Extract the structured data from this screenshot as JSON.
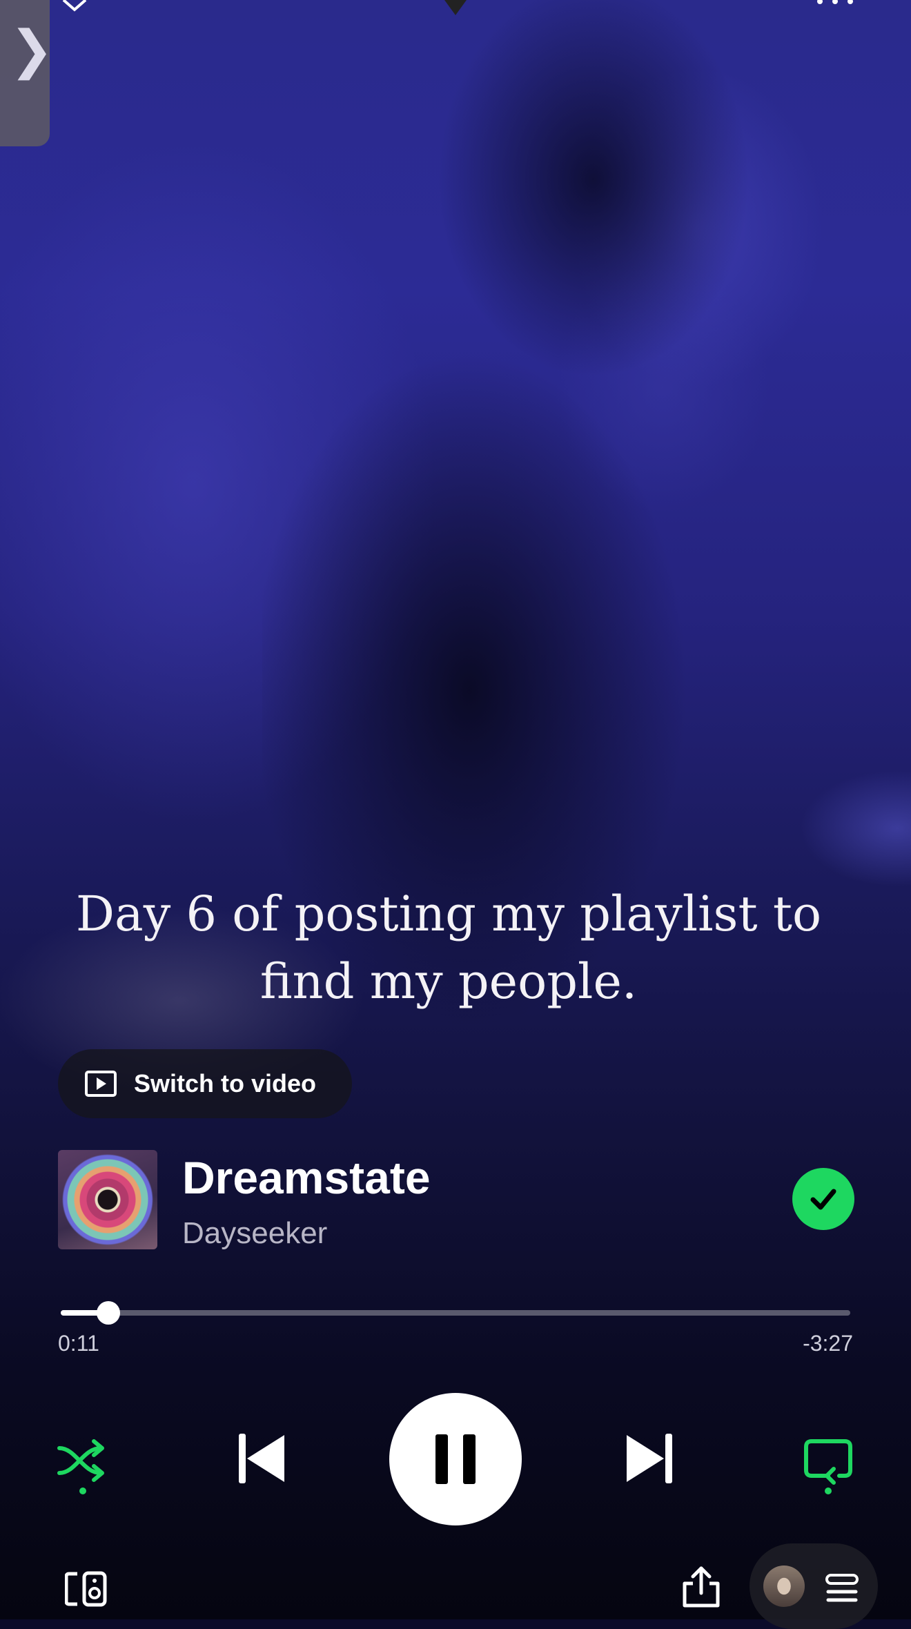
{
  "caption": "Day 6 of posting my playlist to find my people.",
  "switch_video": {
    "label": "Switch to video"
  },
  "track": {
    "title": "Dreamstate",
    "artist": "Dayseeker",
    "saved": true
  },
  "playback": {
    "elapsed": "0:11",
    "remaining": "-3:27",
    "progress_fraction": 0.06,
    "state": "playing"
  },
  "controls": {
    "shuffle_active": true,
    "repeat_active": true
  },
  "colors": {
    "accent": "#1ed760",
    "background_top": "#2c2b95",
    "background_bottom": "#050510"
  },
  "icons": {
    "side_tab": "chevron-right-icon",
    "shuffle": "shuffle-icon",
    "previous": "skip-previous-icon",
    "play_pause": "pause-icon",
    "next": "skip-next-icon",
    "repeat": "repeat-icon",
    "devices": "connect-device-icon",
    "share": "share-icon",
    "queue": "queue-icon",
    "saved": "check-icon",
    "switch_video": "play-square-icon"
  }
}
